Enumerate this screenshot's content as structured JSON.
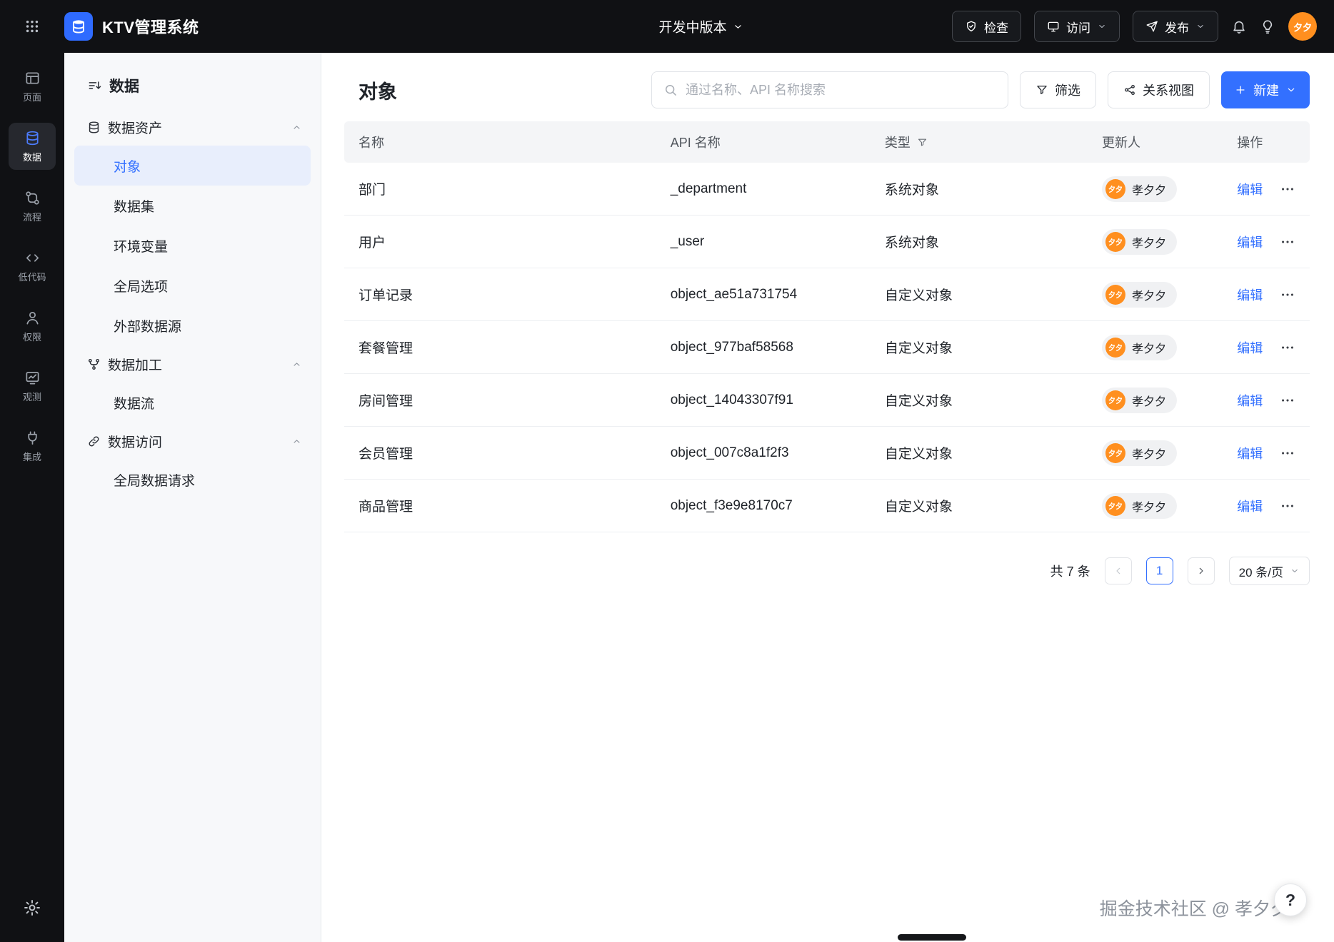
{
  "colors": {
    "primary": "#3370ff",
    "topbar_bg": "#101114",
    "avatar_orange": "#ff8f1f",
    "sidebar_selected_bg": "#e8eefc"
  },
  "topbar": {
    "app_title": "KTV管理系统",
    "version_label": "开发中版本",
    "check_label": "检查",
    "visit_label": "访问",
    "publish_label": "发布",
    "avatar_text": "夕夕"
  },
  "rail": {
    "items": [
      {
        "label": "页面",
        "icon": "page-icon",
        "selected": false
      },
      {
        "label": "数据",
        "icon": "database-icon",
        "selected": true
      },
      {
        "label": "流程",
        "icon": "flow-icon",
        "selected": false
      },
      {
        "label": "低代码",
        "icon": "code-icon",
        "selected": false
      },
      {
        "label": "权限",
        "icon": "permission-icon",
        "selected": false
      },
      {
        "label": "观测",
        "icon": "observe-icon",
        "selected": false
      },
      {
        "label": "集成",
        "icon": "integration-icon",
        "selected": false
      }
    ]
  },
  "sidebar": {
    "title": "数据",
    "items": [
      {
        "type": "group",
        "label": "数据资产",
        "icon": "database-icon"
      },
      {
        "type": "child",
        "label": "对象",
        "selected": true
      },
      {
        "type": "child",
        "label": "数据集",
        "selected": false
      },
      {
        "type": "child",
        "label": "环境变量",
        "selected": false
      },
      {
        "type": "child",
        "label": "全局选项",
        "selected": false
      },
      {
        "type": "child",
        "label": "外部数据源",
        "selected": false
      },
      {
        "type": "group",
        "label": "数据加工",
        "icon": "branch-icon"
      },
      {
        "type": "child",
        "label": "数据流",
        "selected": false
      },
      {
        "type": "group",
        "label": "数据访问",
        "icon": "link-icon"
      },
      {
        "type": "child",
        "label": "全局数据请求",
        "selected": false
      }
    ]
  },
  "main": {
    "title": "对象",
    "search_placeholder": "通过名称、API 名称搜索",
    "filter_label": "筛选",
    "relation_label": "关系视图",
    "create_label": "新建",
    "table": {
      "headers": [
        {
          "label": "名称",
          "filter": false
        },
        {
          "label": "API 名称",
          "filter": false
        },
        {
          "label": "类型",
          "filter": true
        },
        {
          "label": "更新人",
          "filter": false
        },
        {
          "label": "操作",
          "filter": false
        }
      ],
      "rows": [
        {
          "name": "部门",
          "api": "_department",
          "type": "系统对象",
          "avatar": "夕夕",
          "updater": "孝夕夕",
          "edit": "编辑"
        },
        {
          "name": "用户",
          "api": "_user",
          "type": "系统对象",
          "avatar": "夕夕",
          "updater": "孝夕夕",
          "edit": "编辑"
        },
        {
          "name": "订单记录",
          "api": "object_ae51a731754",
          "type": "自定义对象",
          "avatar": "夕夕",
          "updater": "孝夕夕",
          "edit": "编辑"
        },
        {
          "name": "套餐管理",
          "api": "object_977baf58568",
          "type": "自定义对象",
          "avatar": "夕夕",
          "updater": "孝夕夕",
          "edit": "编辑"
        },
        {
          "name": "房间管理",
          "api": "object_14043307f91",
          "type": "自定义对象",
          "avatar": "夕夕",
          "updater": "孝夕夕",
          "edit": "编辑"
        },
        {
          "name": "会员管理",
          "api": "object_007c8a1f2f3",
          "type": "自定义对象",
          "avatar": "夕夕",
          "updater": "孝夕夕",
          "edit": "编辑"
        },
        {
          "name": "商品管理",
          "api": "object_f3e9e8170c7",
          "type": "自定义对象",
          "avatar": "夕夕",
          "updater": "孝夕夕",
          "edit": "编辑"
        }
      ]
    },
    "pagination": {
      "total_label": "共 7 条",
      "current_page": "1",
      "page_size_label": "20 条/页"
    }
  },
  "footer": {
    "watermark": "掘金技术社区 @ 孝夕夕",
    "help_label": "?"
  }
}
